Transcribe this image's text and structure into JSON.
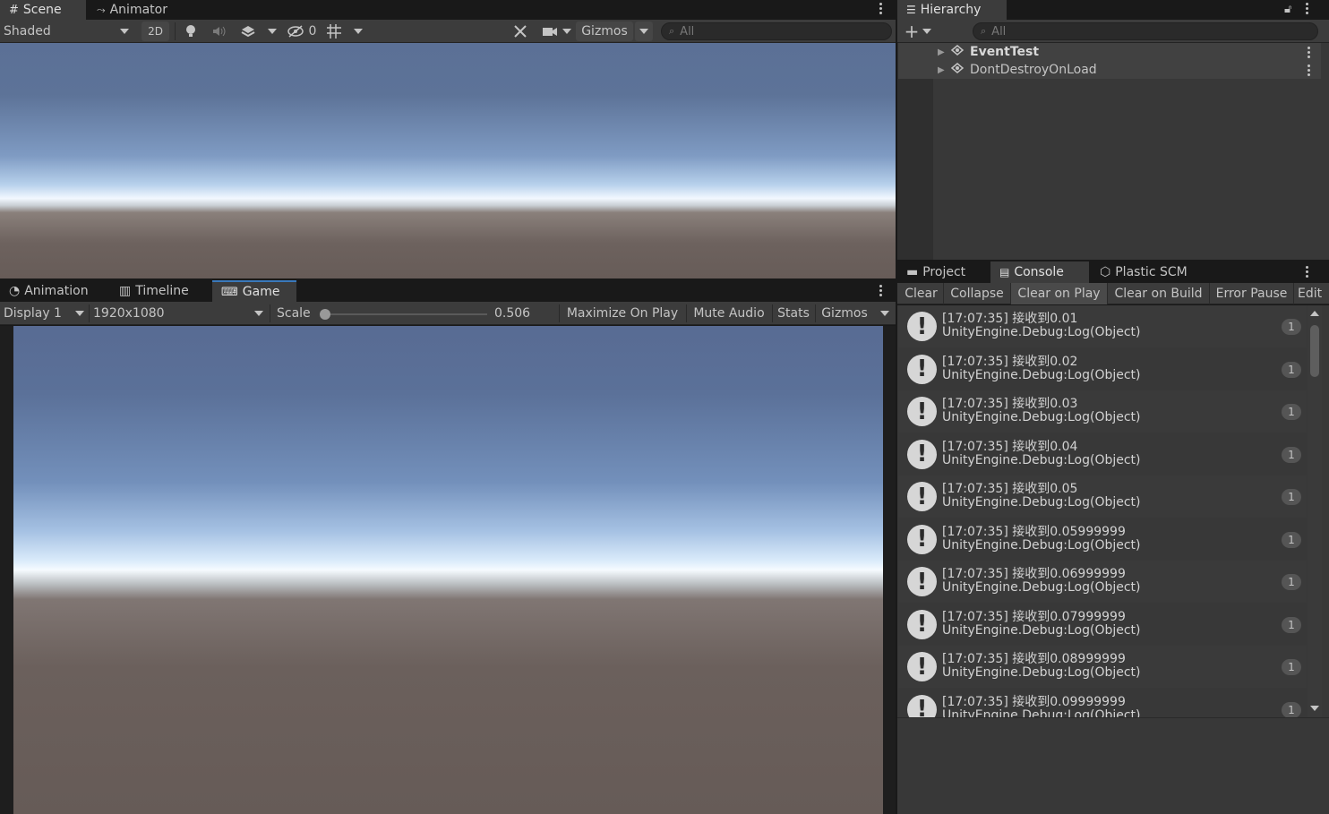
{
  "scene_panel": {
    "tabs": [
      "Scene",
      "Animator"
    ],
    "shading_mode": "Shaded",
    "btn_2d": "2D",
    "hidden_count": "0",
    "gizmos_label": "Gizmos",
    "search_placeholder": "All"
  },
  "hierarchy": {
    "tab": "Hierarchy",
    "search_placeholder": "All",
    "items": [
      "EventTest",
      "DontDestroyOnLoad"
    ]
  },
  "game_panel": {
    "tabs": [
      "Animation",
      "Timeline",
      "Game"
    ],
    "display": "Display 1",
    "resolution": "1920x1080",
    "scale_label": "Scale",
    "scale_value": "0.506",
    "buttons": [
      "Maximize On Play",
      "Mute Audio",
      "Stats",
      "Gizmos"
    ]
  },
  "console_panel": {
    "tabs": [
      "Project",
      "Console",
      "Plastic SCM"
    ],
    "toolbar": [
      "Clear",
      "Collapse",
      "Clear on Play",
      "Clear on Build",
      "Error Pause",
      "Edit"
    ],
    "entries": [
      {
        "message": "[17:07:35] 接收到0.01",
        "trace": "UnityEngine.Debug:Log(Object)",
        "count": "1"
      },
      {
        "message": "[17:07:35] 接收到0.02",
        "trace": "UnityEngine.Debug:Log(Object)",
        "count": "1"
      },
      {
        "message": "[17:07:35] 接收到0.03",
        "trace": "UnityEngine.Debug:Log(Object)",
        "count": "1"
      },
      {
        "message": "[17:07:35] 接收到0.04",
        "trace": "UnityEngine.Debug:Log(Object)",
        "count": "1"
      },
      {
        "message": "[17:07:35] 接收到0.05",
        "trace": "UnityEngine.Debug:Log(Object)",
        "count": "1"
      },
      {
        "message": "[17:07:35] 接收到0.05999999",
        "trace": "UnityEngine.Debug:Log(Object)",
        "count": "1"
      },
      {
        "message": "[17:07:35] 接收到0.06999999",
        "trace": "UnityEngine.Debug:Log(Object)",
        "count": "1"
      },
      {
        "message": "[17:07:35] 接收到0.07999999",
        "trace": "UnityEngine.Debug:Log(Object)",
        "count": "1"
      },
      {
        "message": "[17:07:35] 接收到0.08999999",
        "trace": "UnityEngine.Debug:Log(Object)",
        "count": "1"
      },
      {
        "message": "[17:07:35] 接收到0.09999999",
        "trace": "UnityEngine.Debug:Log(Object)",
        "count": "1"
      }
    ]
  }
}
